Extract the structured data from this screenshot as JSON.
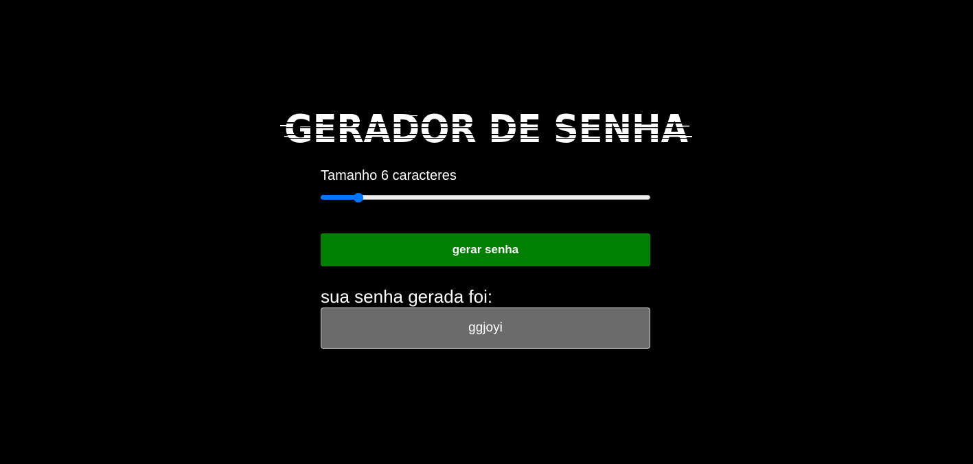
{
  "header": {
    "title": "GERADOR DE SENHA"
  },
  "length_control": {
    "label": "Tamanho 6 caracteres",
    "value": 6,
    "min": 1,
    "max": 100
  },
  "generate_button": {
    "label": "gerar senha"
  },
  "result": {
    "label": "sua senha gerada foi:",
    "password": "ggjoyi"
  },
  "colors": {
    "background": "#000000",
    "text": "#ffffff",
    "button": "#008000",
    "slider_accent": "#0075ff",
    "result_box": "#6b6b6b"
  }
}
